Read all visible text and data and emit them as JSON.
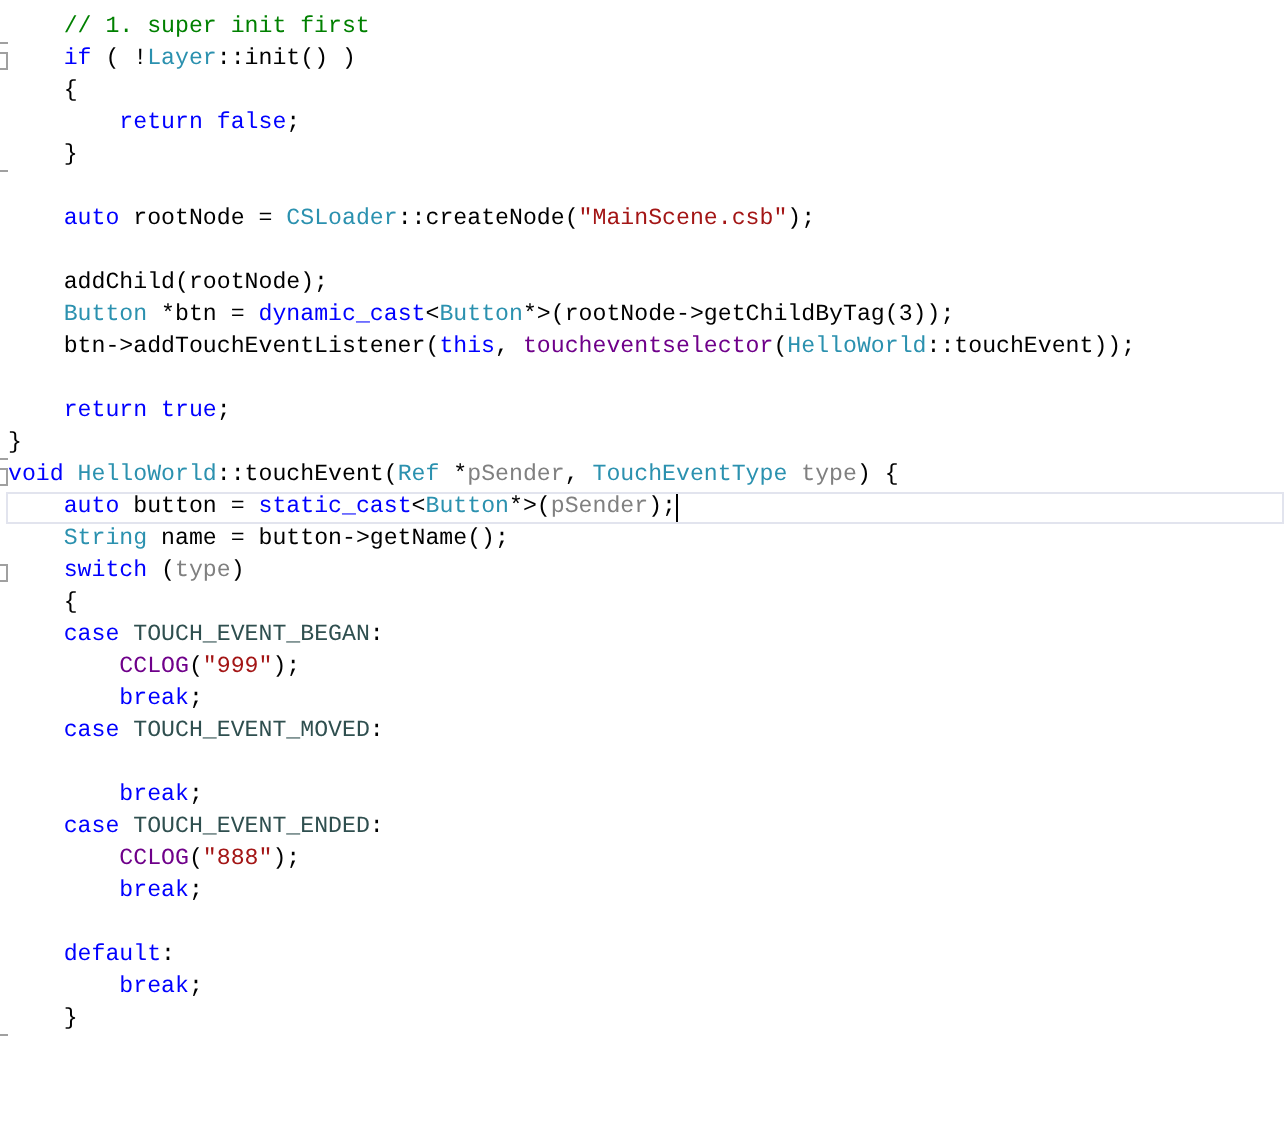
{
  "editor": {
    "lines": [
      {
        "kind": "blank"
      },
      {
        "kind": "code",
        "block_end": true,
        "tokens": [
          {
            "text": "    // 1. super init first",
            "kind": "comment"
          }
        ]
      },
      {
        "kind": "code",
        "collapsible": true,
        "tokens": [
          {
            "text": "    if",
            "kind": "keyword"
          },
          {
            "text": " ( !",
            "kind": "plain"
          },
          {
            "text": "Layer",
            "kind": "type"
          },
          {
            "text": "::init() )",
            "kind": "plain"
          }
        ]
      },
      {
        "kind": "code",
        "tokens": [
          {
            "text": "    {",
            "kind": "plain"
          }
        ]
      },
      {
        "kind": "code",
        "tokens": [
          {
            "text": "        return false",
            "kind": "keyword"
          },
          {
            "text": ";",
            "kind": "plain"
          }
        ]
      },
      {
        "kind": "code",
        "block_end": true,
        "tokens": [
          {
            "text": "    }",
            "kind": "plain"
          }
        ]
      },
      {
        "kind": "blank"
      },
      {
        "kind": "code",
        "tokens": [
          {
            "text": "    auto",
            "kind": "keyword"
          },
          {
            "text": " rootNode = ",
            "kind": "plain"
          },
          {
            "text": "CSLoader",
            "kind": "type"
          },
          {
            "text": "::createNode(",
            "kind": "plain"
          },
          {
            "text": "\"MainScene.csb\"",
            "kind": "string"
          },
          {
            "text": ");",
            "kind": "plain"
          }
        ]
      },
      {
        "kind": "blank"
      },
      {
        "kind": "code",
        "tokens": [
          {
            "text": "    addChild(rootNode);",
            "kind": "plain"
          }
        ]
      },
      {
        "kind": "code",
        "tokens": [
          {
            "text": "    Button",
            "kind": "type"
          },
          {
            "text": " *btn = ",
            "kind": "plain"
          },
          {
            "text": "dynamic_cast",
            "kind": "keyword"
          },
          {
            "text": "<",
            "kind": "plain"
          },
          {
            "text": "Button",
            "kind": "type"
          },
          {
            "text": "*>(rootNode->getChildByTag(3));",
            "kind": "plain"
          }
        ]
      },
      {
        "kind": "code",
        "tokens": [
          {
            "text": "    btn->addTouchEventListener(",
            "kind": "plain"
          },
          {
            "text": "this",
            "kind": "keyword"
          },
          {
            "text": ", ",
            "kind": "plain"
          },
          {
            "text": "toucheventselector",
            "kind": "macro"
          },
          {
            "text": "(",
            "kind": "plain"
          },
          {
            "text": "HelloWorld",
            "kind": "type"
          },
          {
            "text": "::touchEvent));",
            "kind": "plain"
          }
        ]
      },
      {
        "kind": "blank"
      },
      {
        "kind": "code",
        "tokens": [
          {
            "text": "    return true",
            "kind": "keyword"
          },
          {
            "text": ";",
            "kind": "plain"
          }
        ]
      },
      {
        "kind": "code",
        "block_end": true,
        "tokens": [
          {
            "text": "}",
            "kind": "plain"
          }
        ]
      },
      {
        "kind": "code",
        "collapsible": true,
        "tokens": [
          {
            "text": "void",
            "kind": "keyword"
          },
          {
            "text": " HelloWorld",
            "kind": "type"
          },
          {
            "text": "::touchEvent(",
            "kind": "plain"
          },
          {
            "text": "Ref",
            "kind": "type"
          },
          {
            "text": " *",
            "kind": "plain"
          },
          {
            "text": "pSender",
            "kind": "param"
          },
          {
            "text": ", ",
            "kind": "plain"
          },
          {
            "text": "TouchEventType",
            "kind": "type"
          },
          {
            "text": " type",
            "kind": "param"
          },
          {
            "text": ") {",
            "kind": "plain"
          }
        ]
      },
      {
        "kind": "code",
        "current": true,
        "tokens": [
          {
            "text": "    auto",
            "kind": "keyword"
          },
          {
            "text": " button = ",
            "kind": "plain"
          },
          {
            "text": "static_cast",
            "kind": "keyword"
          },
          {
            "text": "<",
            "kind": "plain"
          },
          {
            "text": "Button",
            "kind": "type"
          },
          {
            "text": "*>(",
            "kind": "plain"
          },
          {
            "text": "pSender",
            "kind": "param"
          },
          {
            "text": ");",
            "kind": "plain"
          }
        ]
      },
      {
        "kind": "code",
        "tokens": [
          {
            "text": "    String",
            "kind": "type"
          },
          {
            "text": " name = button->getName();",
            "kind": "plain"
          }
        ]
      },
      {
        "kind": "code",
        "collapsible": true,
        "tokens": [
          {
            "text": "    switch",
            "kind": "keyword"
          },
          {
            "text": " (",
            "kind": "plain"
          },
          {
            "text": "type",
            "kind": "param"
          },
          {
            "text": ")",
            "kind": "plain"
          }
        ]
      },
      {
        "kind": "code",
        "tokens": [
          {
            "text": "    {",
            "kind": "plain"
          }
        ]
      },
      {
        "kind": "code",
        "tokens": [
          {
            "text": "    case",
            "kind": "keyword"
          },
          {
            "text": " TOUCH_EVENT_BEGAN",
            "kind": "enum"
          },
          {
            "text": ":",
            "kind": "plain"
          }
        ]
      },
      {
        "kind": "code",
        "tokens": [
          {
            "text": "        CCLOG",
            "kind": "macro"
          },
          {
            "text": "(",
            "kind": "plain"
          },
          {
            "text": "\"999\"",
            "kind": "string"
          },
          {
            "text": ");",
            "kind": "plain"
          }
        ]
      },
      {
        "kind": "code",
        "tokens": [
          {
            "text": "        break",
            "kind": "keyword"
          },
          {
            "text": ";",
            "kind": "plain"
          }
        ]
      },
      {
        "kind": "code",
        "tokens": [
          {
            "text": "    case",
            "kind": "keyword"
          },
          {
            "text": " TOUCH_EVENT_MOVED",
            "kind": "enum"
          },
          {
            "text": ":",
            "kind": "plain"
          }
        ]
      },
      {
        "kind": "blank"
      },
      {
        "kind": "code",
        "tokens": [
          {
            "text": "        break",
            "kind": "keyword"
          },
          {
            "text": ";",
            "kind": "plain"
          }
        ]
      },
      {
        "kind": "code",
        "tokens": [
          {
            "text": "    case",
            "kind": "keyword"
          },
          {
            "text": " TOUCH_EVENT_ENDED",
            "kind": "enum"
          },
          {
            "text": ":",
            "kind": "plain"
          }
        ]
      },
      {
        "kind": "code",
        "tokens": [
          {
            "text": "        CCLOG",
            "kind": "macro"
          },
          {
            "text": "(",
            "kind": "plain"
          },
          {
            "text": "\"888\"",
            "kind": "string"
          },
          {
            "text": ");",
            "kind": "plain"
          }
        ]
      },
      {
        "kind": "code",
        "tokens": [
          {
            "text": "        break",
            "kind": "keyword"
          },
          {
            "text": ";",
            "kind": "plain"
          }
        ]
      },
      {
        "kind": "blank"
      },
      {
        "kind": "code",
        "tokens": [
          {
            "text": "    default",
            "kind": "keyword"
          },
          {
            "text": ":",
            "kind": "plain"
          }
        ]
      },
      {
        "kind": "code",
        "tokens": [
          {
            "text": "        break",
            "kind": "keyword"
          },
          {
            "text": ";",
            "kind": "plain"
          }
        ]
      },
      {
        "kind": "code",
        "block_end": true,
        "tokens": [
          {
            "text": "    }",
            "kind": "plain"
          }
        ]
      }
    ]
  }
}
